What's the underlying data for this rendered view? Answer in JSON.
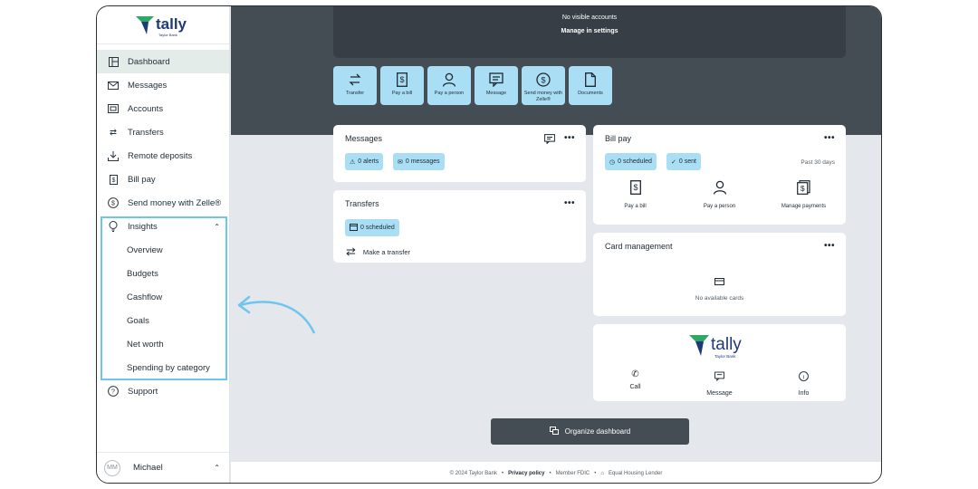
{
  "brand": {
    "name": "tally",
    "sub": "Taylor Bank"
  },
  "sidebar": {
    "items": [
      {
        "label": "Dashboard",
        "icon": "dashboard-icon"
      },
      {
        "label": "Messages",
        "icon": "mail-icon"
      },
      {
        "label": "Accounts",
        "icon": "accounts-icon"
      },
      {
        "label": "Transfers",
        "icon": "transfer-icon"
      },
      {
        "label": "Remote deposits",
        "icon": "download-icon"
      },
      {
        "label": "Bill pay",
        "icon": "bill-icon"
      },
      {
        "label": "Send money with Zelle®",
        "icon": "dollar-icon"
      },
      {
        "label": "Insights",
        "icon": "lightbulb-icon"
      }
    ],
    "insights_sub": [
      "Overview",
      "Budgets",
      "Cashflow",
      "Goals",
      "Net worth",
      "Spending by category"
    ],
    "support": "Support",
    "user": {
      "initials": "MM",
      "name": "Michael"
    }
  },
  "accounts_banner": {
    "line1": "No visible accounts",
    "line2": "Manage in settings"
  },
  "quick_actions": [
    {
      "label": "Transfer",
      "icon": "transfer-icon"
    },
    {
      "label": "Pay a bill",
      "icon": "bill-icon"
    },
    {
      "label": "Pay a person",
      "icon": "person-icon"
    },
    {
      "label": "Message",
      "icon": "message-icon"
    },
    {
      "label": "Send money with Zelle®",
      "icon": "dollar-icon"
    },
    {
      "label": "Documents",
      "icon": "document-icon"
    }
  ],
  "messages_card": {
    "title": "Messages",
    "alerts": "0 alerts",
    "messages": "0 messages"
  },
  "transfers_card": {
    "title": "Transfers",
    "scheduled": "0 scheduled",
    "make": "Make a transfer"
  },
  "billpay_card": {
    "title": "Bill pay",
    "scheduled": "0 scheduled",
    "sent": "0 sent",
    "period": "Past 30 days",
    "actions": [
      "Pay a bill",
      "Pay a person",
      "Manage payments"
    ]
  },
  "card_mgmt": {
    "title": "Card management",
    "empty": "No available cards"
  },
  "contact_card": {
    "actions": [
      "Call",
      "Message",
      "Info"
    ]
  },
  "organize_label": "Organize dashboard",
  "footer": {
    "copyright": "© 2024 Taylor Bank",
    "privacy": "Privacy policy",
    "fdic": "Member FDIC",
    "housing": "Equal Housing Lender"
  },
  "colors": {
    "accent": "#a9def5",
    "highlight_border": "#6ec6ee",
    "hero": "#444c54",
    "brand_green": "#2fa866",
    "brand_navy": "#1e3a78"
  }
}
